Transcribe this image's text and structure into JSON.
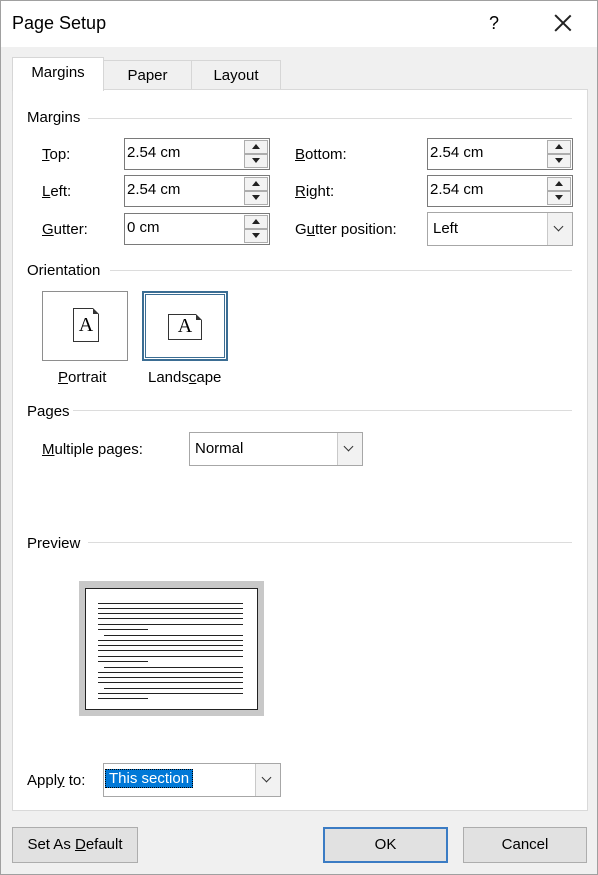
{
  "window": {
    "title": "Page Setup",
    "help_label": "?",
    "close_label": "close"
  },
  "tabs": [
    {
      "label": "Margins",
      "active": true
    },
    {
      "label": "Paper",
      "active": false
    },
    {
      "label": "Layout",
      "active": false
    }
  ],
  "margins": {
    "section_label": "Margins",
    "top": {
      "label_ul": "T",
      "label_rest": "op:",
      "value": "2.54 cm"
    },
    "bottom": {
      "label_ul": "B",
      "label_rest": "ottom:",
      "value": "2.54 cm"
    },
    "left": {
      "label_ul": "L",
      "label_rest": "eft:",
      "value": "2.54 cm"
    },
    "right": {
      "label_ul": "R",
      "label_rest": "ight:",
      "value": "2.54 cm"
    },
    "gutter": {
      "label_pre": "",
      "label_ul": "G",
      "label_rest": "utter:",
      "value": "0 cm"
    },
    "gutter_position": {
      "label_pre": "G",
      "label_ul": "u",
      "label_rest": "tter position:",
      "value": "Left"
    }
  },
  "orientation": {
    "section_label": "Orientation",
    "portrait": {
      "label_ul": "P",
      "label_rest": "ortrait",
      "selected": false,
      "glyph": "A"
    },
    "landscape": {
      "label_pre": "Lands",
      "label_ul": "c",
      "label_rest": "ape",
      "selected": true,
      "glyph": "A"
    }
  },
  "pages": {
    "section_label": "Pages",
    "multiple_pages": {
      "label_ul": "M",
      "label_rest": "ultiple pages:",
      "value": "Normal"
    }
  },
  "preview": {
    "section_label": "Preview"
  },
  "apply_to": {
    "label_pre": "Appl",
    "label_ul": "y",
    "label_rest": " to:",
    "value": "This section"
  },
  "buttons": {
    "set_default_pre": "Set As ",
    "set_default_ul": "D",
    "set_default_rest": "efault",
    "ok": "OK",
    "cancel": "Cancel"
  },
  "colors": {
    "accent": "#0078d7",
    "selected_border": "#3b6d93",
    "default_button_border": "#3b7cc4"
  }
}
